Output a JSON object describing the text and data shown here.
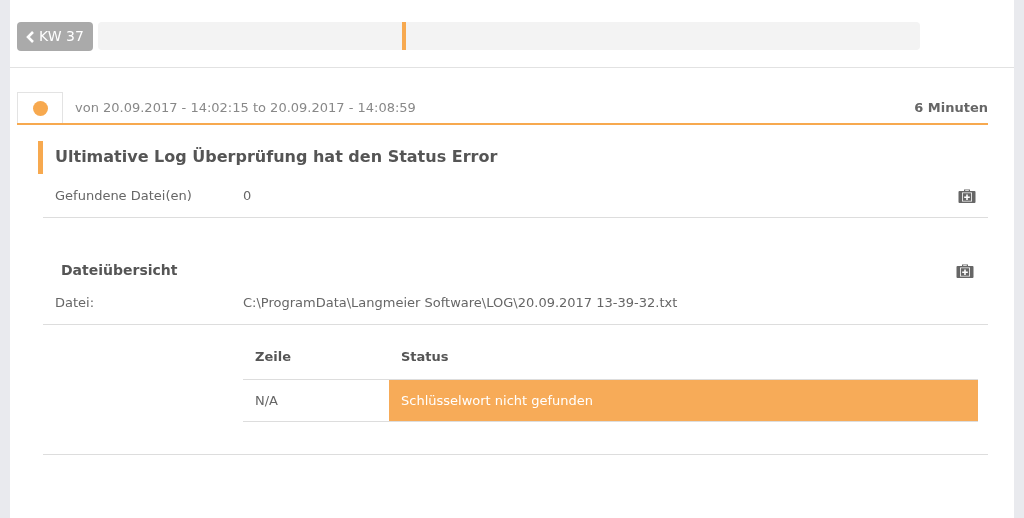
{
  "week_button": {
    "label": "KW 37"
  },
  "timeline": {
    "level": 0.37
  },
  "run": {
    "color": "#f7a94f",
    "period": "von 20.09.2017 - 14:02:15 to 20.09.2017 - 14:08:59",
    "duration": "6 Minuten"
  },
  "check": {
    "title": "Ultimative Log Überprüfung hat den Status Error",
    "label": "Gefundene Datei(en)",
    "value": "0"
  },
  "file_overview": {
    "title": "Dateiübersicht",
    "label": "Datei:",
    "value": "C:\\ProgramData\\Langmeier Software\\LOG\\20.09.2017 13-39-32.txt"
  },
  "table": {
    "columns": [
      "Zeile",
      "Status"
    ],
    "rows": [
      {
        "line": "N/A",
        "status": "Schlüsselwort nicht gefunden",
        "color": "#f7ab58"
      }
    ]
  }
}
